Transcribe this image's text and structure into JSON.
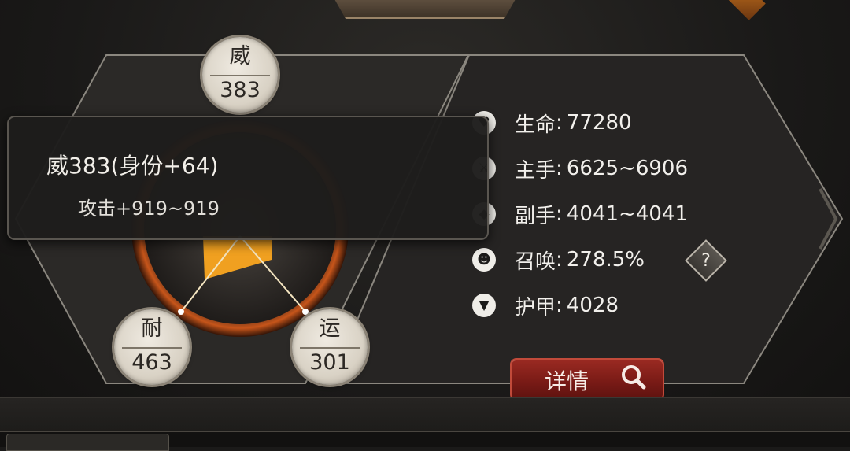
{
  "attributes": [
    {
      "name": "威",
      "value": "383"
    },
    {
      "name": "耐",
      "value": "463"
    },
    {
      "name": "运",
      "value": "301"
    }
  ],
  "tooltip": {
    "title": "威383(身份+64)",
    "effect": "攻击+919~919"
  },
  "stats": [
    {
      "icon": "heart-icon",
      "label": "生命",
      "value": "77280"
    },
    {
      "icon": "sword-icon",
      "label": "主手",
      "value": "6625~6906"
    },
    {
      "icon": "shield-icon",
      "label": "副手",
      "value": "4041~4041"
    },
    {
      "icon": "summon-icon",
      "label": "召唤",
      "value": "278.5%"
    },
    {
      "icon": "armor-icon",
      "label": "护甲",
      "value": "4028"
    }
  ],
  "stat_separator": ":",
  "help_label": "?",
  "details_button": "详情",
  "colors": {
    "accent_orange": "#f0a020",
    "button_red": "#8a221c"
  }
}
